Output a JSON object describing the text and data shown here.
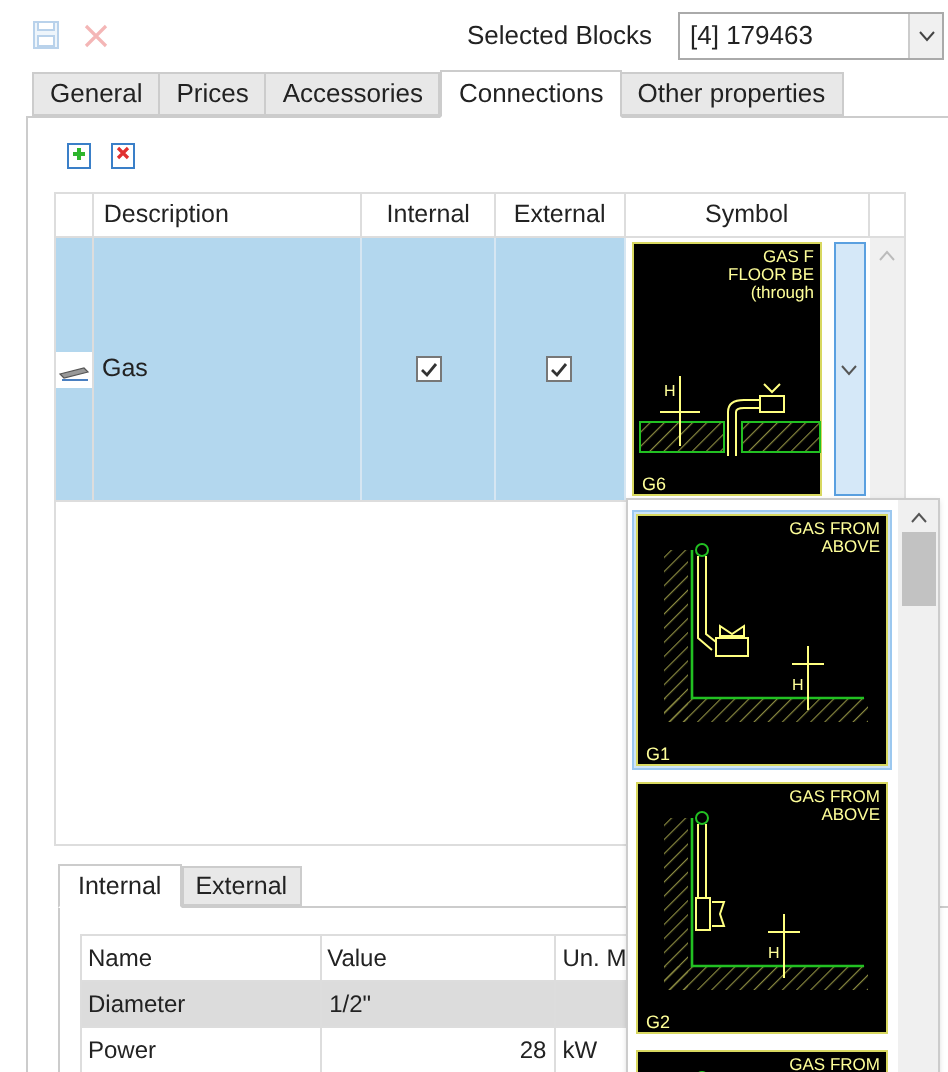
{
  "toolbar": [
    {
      "kind": "save",
      "disabled": true
    },
    {
      "kind": "delete",
      "disabled": true
    }
  ],
  "selected_blocks": {
    "label": "Selected Blocks",
    "value": "[4] 179463"
  },
  "tabs": [
    {
      "label": "General",
      "selected": false
    },
    {
      "label": "Prices",
      "selected": false
    },
    {
      "label": "Accessories",
      "selected": false
    },
    {
      "label": "Connections",
      "selected": true
    },
    {
      "label": "Other properties",
      "selected": false
    }
  ],
  "connections": {
    "columns": [
      "Description",
      "Internal",
      "External",
      "Symbol"
    ],
    "rows": [
      {
        "description": "Gas",
        "internal": true,
        "external": true,
        "selected": true,
        "symbol": {
          "kind": "floor",
          "caption": [
            "GAS F",
            "FLOOR BE",
            "(through"
          ],
          "dimension": "H",
          "code": "G6"
        }
      }
    ]
  },
  "symbol_dropdown": {
    "expanded": true,
    "items": [
      {
        "kind": "wall-top",
        "caption": [
          "GAS FROM",
          "ABOVE"
        ],
        "dimension": "H",
        "code": "G1",
        "selected": true
      },
      {
        "kind": "wall-side",
        "caption": [
          "GAS FROM",
          "ABOVE"
        ],
        "dimension": "H",
        "code": "G2",
        "selected": false
      },
      {
        "kind": "partial",
        "caption": [
          "GAS FROM"
        ],
        "selected": false
      }
    ]
  },
  "detail_tabs": [
    {
      "label": "Internal",
      "selected": true
    },
    {
      "label": "External",
      "selected": false
    }
  ],
  "properties": {
    "columns": [
      "Name",
      "Value",
      "Un. M"
    ],
    "rows": [
      {
        "name": "Diameter",
        "value": "1/2\"",
        "kind": "text",
        "selected": true
      },
      {
        "name": "Power",
        "value": "28",
        "kind": "number",
        "unit": "kW",
        "selected": false
      }
    ]
  }
}
